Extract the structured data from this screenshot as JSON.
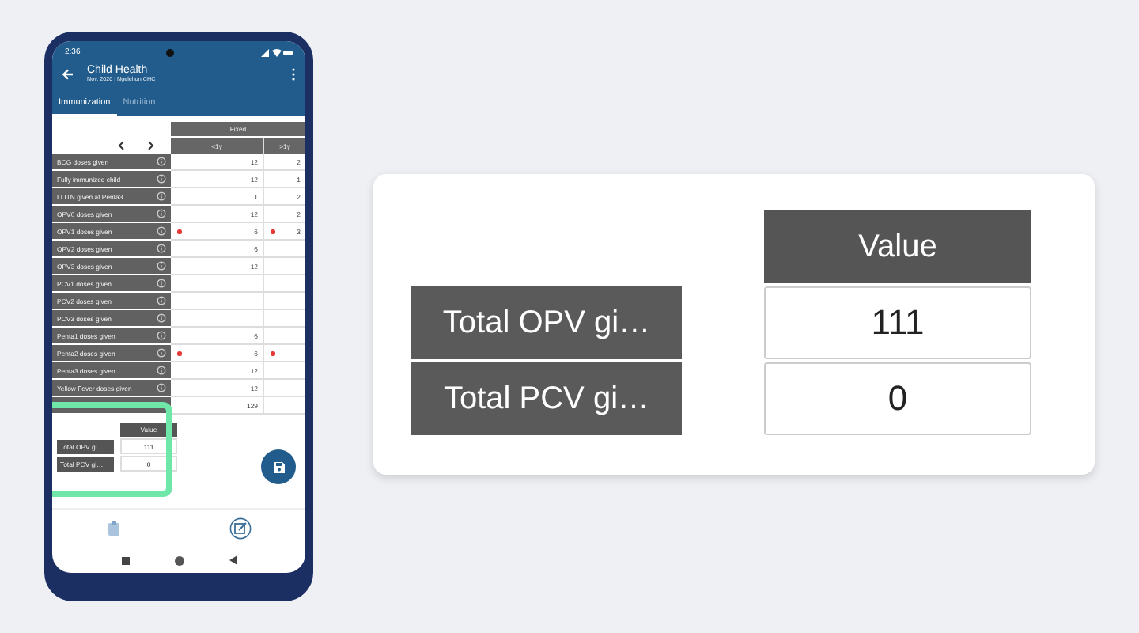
{
  "phone": {
    "status_bar": {
      "time": "2:36"
    },
    "app_bar": {
      "title": "Child Health",
      "subtitle": "Nov. 2020 | Ngelehun CHC"
    },
    "tabs": [
      {
        "label": "Immunization",
        "selected": true
      },
      {
        "label": "Nutrition",
        "selected": false
      }
    ],
    "table": {
      "group_header": "Fixed",
      "columns": [
        "<1y",
        ">1y"
      ],
      "rows": [
        {
          "label": "BCG doses given",
          "cells": [
            {
              "value": "12",
              "flagged": false
            },
            {
              "value": "2",
              "flagged": false
            }
          ]
        },
        {
          "label": "Fully immunized child",
          "cells": [
            {
              "value": "12",
              "flagged": false
            },
            {
              "value": "1",
              "flagged": false
            }
          ]
        },
        {
          "label": "LLITN given at Penta3",
          "cells": [
            {
              "value": "1",
              "flagged": false
            },
            {
              "value": "2",
              "flagged": false
            }
          ]
        },
        {
          "label": "OPV0 doses given",
          "cells": [
            {
              "value": "12",
              "flagged": false
            },
            {
              "value": "2",
              "flagged": false
            }
          ]
        },
        {
          "label": "OPV1 doses given",
          "cells": [
            {
              "value": "6",
              "flagged": true
            },
            {
              "value": "3",
              "flagged": true
            }
          ]
        },
        {
          "label": "OPV2 doses given",
          "cells": [
            {
              "value": "6",
              "flagged": false
            },
            {
              "flagged": false
            }
          ]
        },
        {
          "label": "OPV3 doses given",
          "cells": [
            {
              "value": "12",
              "flagged": false
            },
            {
              "flagged": false
            }
          ]
        },
        {
          "label": "PCV1 doses given",
          "cells": [
            {
              "flagged": false
            },
            {
              "flagged": false
            }
          ]
        },
        {
          "label": "PCV2 doses given",
          "cells": [
            {
              "flagged": false
            },
            {
              "flagged": false
            }
          ]
        },
        {
          "label": "PCV3 doses given",
          "cells": [
            {
              "flagged": false
            },
            {
              "flagged": false
            }
          ]
        },
        {
          "label": "Penta1 doses given",
          "cells": [
            {
              "value": "6",
              "flagged": false
            },
            {
              "flagged": false
            }
          ]
        },
        {
          "label": "Penta2 doses given",
          "cells": [
            {
              "value": "6",
              "flagged": true
            },
            {
              "flagged": true
            }
          ]
        },
        {
          "label": "Penta3 doses given",
          "cells": [
            {
              "value": "12",
              "flagged": false
            },
            {
              "flagged": false
            }
          ]
        },
        {
          "label": "Yellow Fever doses given",
          "cells": [
            {
              "value": "12",
              "flagged": false
            },
            {
              "flagged": false
            }
          ]
        },
        {
          "cells": [
            {
              "value": "129",
              "flagged": false
            },
            {
              "flagged": false
            }
          ]
        }
      ]
    },
    "summary": {
      "header": "Value",
      "rows": [
        {
          "label": "Total OPV gi…",
          "value": "111"
        },
        {
          "label": "Total PCV gi…",
          "value": "0"
        }
      ]
    }
  },
  "callout": {
    "header": "Value",
    "rows": [
      {
        "label": "Total OPV gi…",
        "value": "111"
      },
      {
        "label": "Total PCV gi…",
        "value": "0"
      }
    ]
  }
}
